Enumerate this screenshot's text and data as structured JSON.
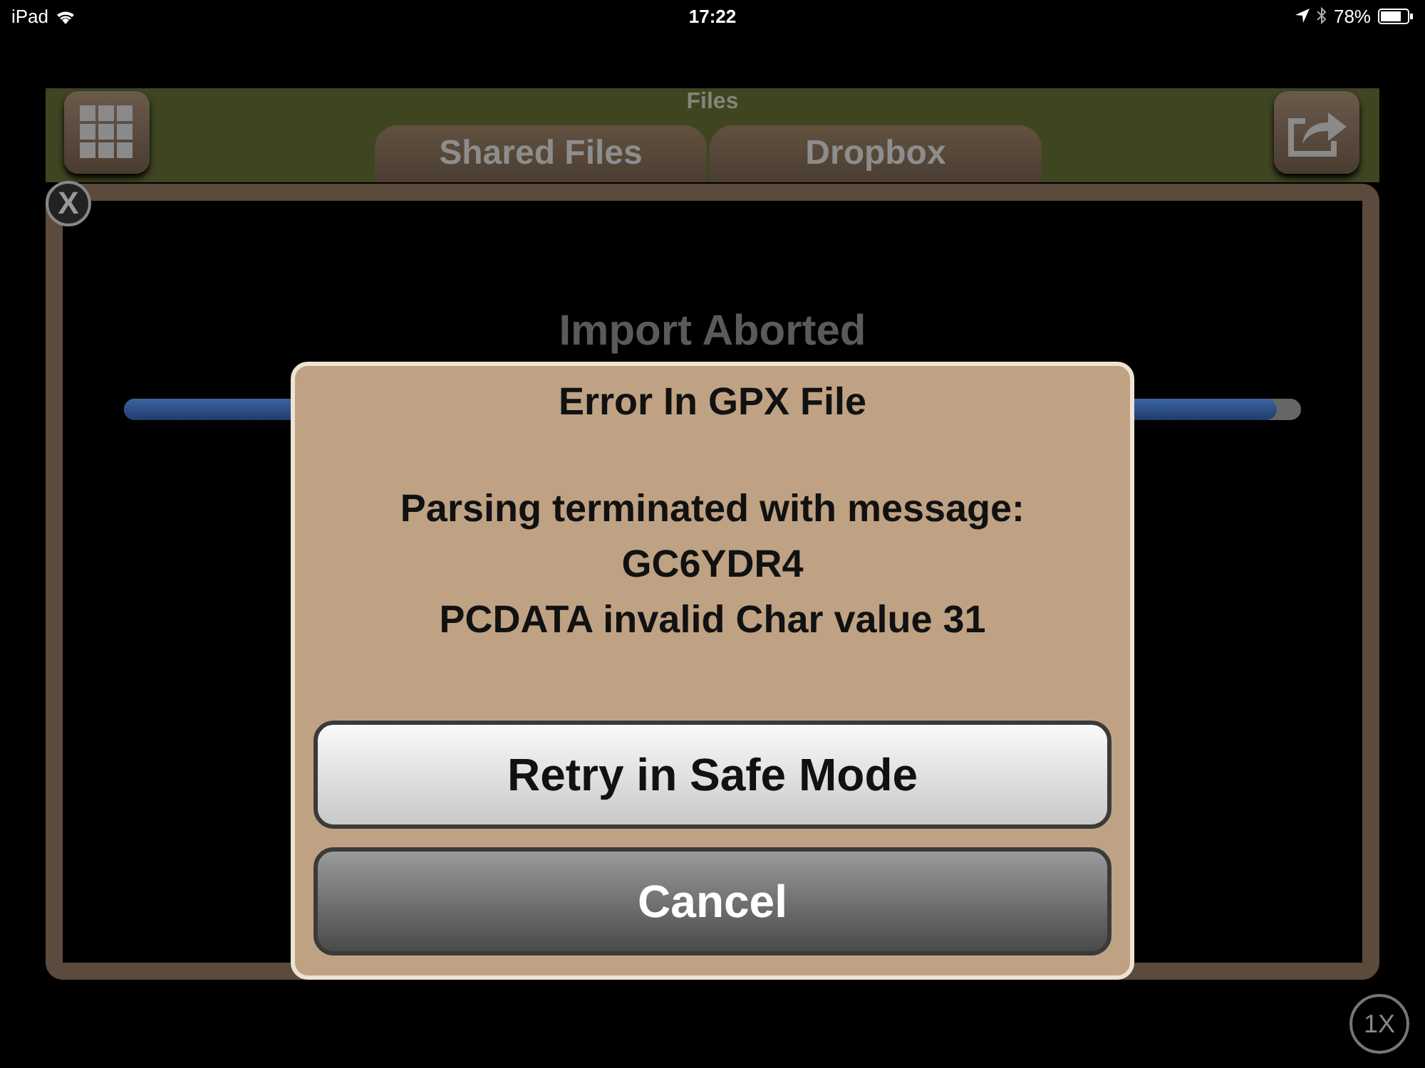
{
  "status_bar": {
    "device": "iPad",
    "time": "17:22",
    "battery": "78%"
  },
  "header": {
    "title": "Files",
    "tabs": [
      {
        "label": "Shared Files"
      },
      {
        "label": "Dropbox"
      }
    ]
  },
  "close_button": {
    "label": "X"
  },
  "import": {
    "status": "Import Aborted",
    "level": 0.98
  },
  "dialog": {
    "title": "Error In GPX File",
    "message": "Parsing terminated with message:\nGC6YDR4\nPCDATA invalid Char value 31",
    "buttons": [
      {
        "label": "Retry in Safe Mode",
        "kind": "default"
      },
      {
        "label": "Cancel",
        "kind": "cancel"
      }
    ]
  },
  "zoom_button": {
    "label": "1X"
  }
}
